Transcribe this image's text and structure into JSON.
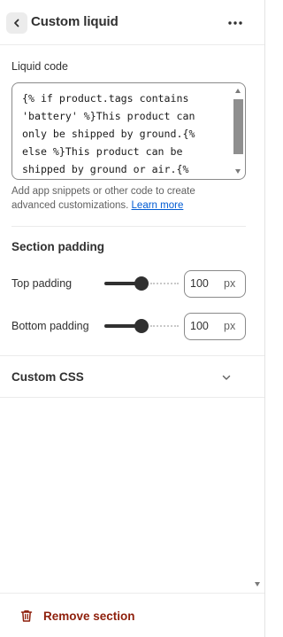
{
  "header": {
    "title": "Custom liquid",
    "back_icon": "chevron-left-icon",
    "menu_icon": "more-horizontal-icon"
  },
  "liquid_code": {
    "label": "Liquid code",
    "value": "{% if product.tags contains\n'battery' %}This product can\nonly be shipped by ground.{%\nelse %}This product can be\nshipped by ground or air.{%",
    "help_text": "Add app snippets or other code to create advanced customizations.",
    "help_link": "Learn more"
  },
  "section_padding": {
    "heading": "Section padding",
    "top": {
      "label": "Top padding",
      "value": "100",
      "unit": "px",
      "slider_fraction": 0.5
    },
    "bottom": {
      "label": "Bottom padding",
      "value": "100",
      "unit": "px",
      "slider_fraction": 0.5
    }
  },
  "custom_css": {
    "title": "Custom CSS",
    "icon": "chevron-down-icon"
  },
  "footer": {
    "remove_label": "Remove section",
    "remove_icon": "trash-icon"
  },
  "colors": {
    "text": "#303030",
    "link": "#005bd3",
    "danger": "#8e1f0b",
    "slider": "#303030"
  }
}
